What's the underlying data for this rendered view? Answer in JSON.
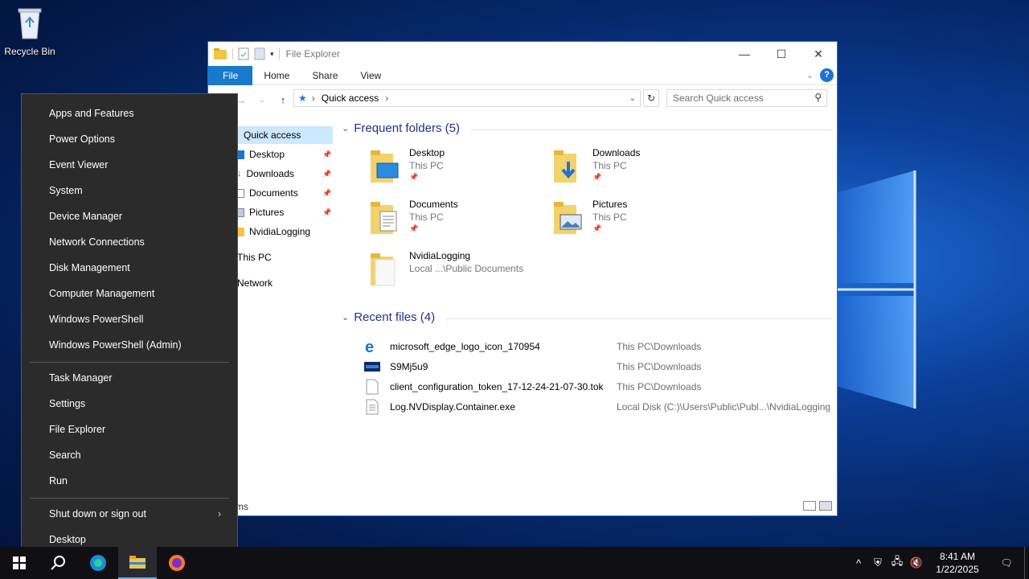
{
  "desktop": {
    "recycle_bin_label": "Recycle Bin"
  },
  "explorer": {
    "title": "File Explorer",
    "ribbon_tabs": [
      "File",
      "Home",
      "Share",
      "View"
    ],
    "address": {
      "location": "Quick access"
    },
    "search_placeholder": "Search Quick access",
    "nav_pane": {
      "items": [
        {
          "label": "Quick access",
          "selected": true
        },
        {
          "label": "Desktop",
          "pinned": true
        },
        {
          "label": "Downloads",
          "pinned": true
        },
        {
          "label": "Documents",
          "pinned": true
        },
        {
          "label": "Pictures",
          "pinned": true
        },
        {
          "label": "NvidiaLogging",
          "pinned": false
        },
        {
          "label": "This PC"
        },
        {
          "label": "Network"
        }
      ]
    },
    "frequent_folders": {
      "header": "Frequent folders (5)",
      "items": [
        {
          "name": "Desktop",
          "location": "This PC",
          "icon": "desktop-folder-icon"
        },
        {
          "name": "Downloads",
          "location": "This PC",
          "icon": "downloads-folder-icon"
        },
        {
          "name": "Documents",
          "location": "This PC",
          "icon": "documents-folder-icon"
        },
        {
          "name": "Pictures",
          "location": "This PC",
          "icon": "pictures-folder-icon"
        },
        {
          "name": "NvidiaLogging",
          "location": "Local ...\\Public Documents",
          "icon": "folder-icon"
        }
      ]
    },
    "recent_files": {
      "header": "Recent files (4)",
      "items": [
        {
          "name": "microsoft_edge_logo_icon_170954",
          "path": "This PC\\Downloads",
          "icon": "edge-file-icon"
        },
        {
          "name": "S9Mj5u9",
          "path": "This PC\\Downloads",
          "icon": "image-file-icon"
        },
        {
          "name": "client_configuration_token_17-12-24-21-07-30.tok",
          "path": "This PC\\Downloads",
          "icon": "blank-file-icon"
        },
        {
          "name": "Log.NVDisplay.Container.exe",
          "path": "Local Disk (C:)\\Users\\Public\\Publ...\\NvidiaLogging",
          "icon": "text-file-icon"
        }
      ]
    },
    "status_count": "ms"
  },
  "winx_menu": {
    "group1": [
      "Apps and Features",
      "Power Options",
      "Event Viewer",
      "System",
      "Device Manager",
      "Network Connections",
      "Disk Management",
      "Computer Management",
      "Windows PowerShell",
      "Windows PowerShell (Admin)"
    ],
    "group2": [
      "Task Manager",
      "Settings",
      "File Explorer",
      "Search",
      "Run"
    ],
    "group3": [
      "Shut down or sign out",
      "Desktop"
    ]
  },
  "taskbar": {
    "time": "8:41 AM",
    "date": "1/22/2025",
    "pinned_apps": [
      "start-icon",
      "search-icon",
      "edge-icon",
      "file-explorer-icon",
      "firefox-icon"
    ]
  },
  "colors": {
    "accent": "#1979ca",
    "menu_bg": "#2b2b2b",
    "taskbar_bg": "#101014",
    "section_header": "#1e3287"
  }
}
